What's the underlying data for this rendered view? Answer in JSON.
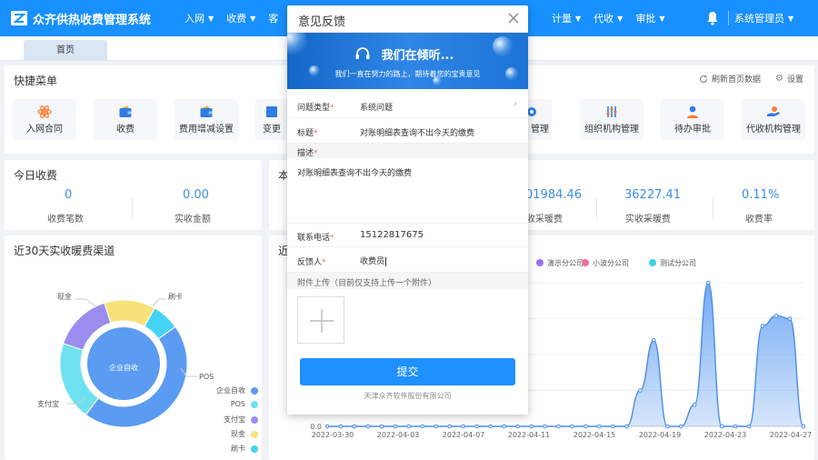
{
  "header": {
    "app_title": "众齐供热收费管理系统",
    "nav_left": [
      {
        "label": "入网"
      },
      {
        "label": "收费"
      },
      {
        "label": "客"
      }
    ],
    "nav_right": [
      {
        "label": "计量"
      },
      {
        "label": "代收"
      },
      {
        "label": "审批"
      }
    ],
    "user": "系统管理员"
  },
  "tabs": {
    "home": "首页"
  },
  "quick_menu": {
    "title": "快捷菜单",
    "refresh": "刷新首页数据",
    "settings": "设置",
    "items": [
      {
        "label": "入网合同",
        "icon": "atom-icon"
      },
      {
        "label": "收费",
        "icon": "wallet-icon"
      },
      {
        "label": "费用增减设置",
        "icon": "wallet-icon"
      },
      {
        "label": "变更",
        "icon": "edit-icon"
      },
      {
        "label": "管理",
        "icon": "eye-icon"
      },
      {
        "label": "组织机构管理",
        "icon": "sliders-icon"
      },
      {
        "label": "待办审批",
        "icon": "user-icon"
      },
      {
        "label": "代收机构管理",
        "icon": "hand-icon"
      }
    ]
  },
  "today": {
    "title": "今日收费",
    "stats": [
      {
        "value": "0",
        "label": "收费笔数"
      },
      {
        "value": "0.00",
        "label": "实收金额"
      }
    ]
  },
  "month": {
    "title": "本",
    "stats": [
      {
        "value": "01984.46",
        "label": "收采暖费"
      },
      {
        "value": "36227.41",
        "label": "实收采暖费"
      },
      {
        "value": "0.11%",
        "label": "收费率"
      }
    ]
  },
  "donut": {
    "title": "近30天实收暖费渠道",
    "center": "企业自收",
    "labels": [
      "现金",
      "刷卡",
      "POS",
      "支付宝"
    ]
  },
  "linechart": {
    "title": "近"
  },
  "chart_data": [
    {
      "type": "pie",
      "title": "近30天实收暖费渠道",
      "categories": [
        "企业自收",
        "POS",
        "支付宝",
        "现金",
        "刷卡"
      ],
      "values": [
        45,
        20,
        15,
        13,
        7
      ],
      "colors": [
        "#5b9bf2",
        "#6ee1f0",
        "#9b8cf0",
        "#f7e27a",
        "#44d3f2"
      ],
      "legend": "bottom-right"
    },
    {
      "type": "area",
      "title": "",
      "series_names": [
        "演示分公司",
        "小波分公司",
        "测试分公司"
      ],
      "series_colors": [
        "#9b6ef0",
        "#f16d9a",
        "#3fd1e8"
      ],
      "x": [
        "2022-03-30",
        "2022-04-03",
        "2022-04-07",
        "2022-04-11",
        "2022-04-15",
        "2022-04-19",
        "2022-04-23",
        "2022-04-27"
      ],
      "values": [
        0,
        0,
        0,
        0,
        0,
        0,
        0,
        0,
        0,
        0,
        0,
        0,
        0,
        0,
        0,
        0,
        0,
        0,
        0,
        0,
        0,
        0,
        0,
        25,
        60,
        0,
        0,
        15,
        100,
        0,
        0,
        0,
        70,
        77,
        75,
        0
      ],
      "ylim": [
        0,
        100
      ],
      "ylabel_min": "0.0",
      "grid": true
    }
  ],
  "modal": {
    "title": "意见反馈",
    "banner_title": "我们在倾听...",
    "banner_sub": "我们一直在努力的路上，期待着您的宝贵意见",
    "fields": {
      "type_label": "问题类型",
      "type_value": "系统问题",
      "subject_label": "标题",
      "subject_value": "对账明细表查询不出今天的缴费",
      "desc_label": "描述",
      "desc_value": "对账明细表查询不出今天的缴费",
      "phone_label": "联系电话",
      "phone_value": "15122817675",
      "person_label": "反馈人",
      "person_value": "收费员",
      "attach_label": "附件上传（目前仅支持上传一个附件）"
    },
    "submit": "提交",
    "company": "天津众齐软件股份有限公司"
  }
}
